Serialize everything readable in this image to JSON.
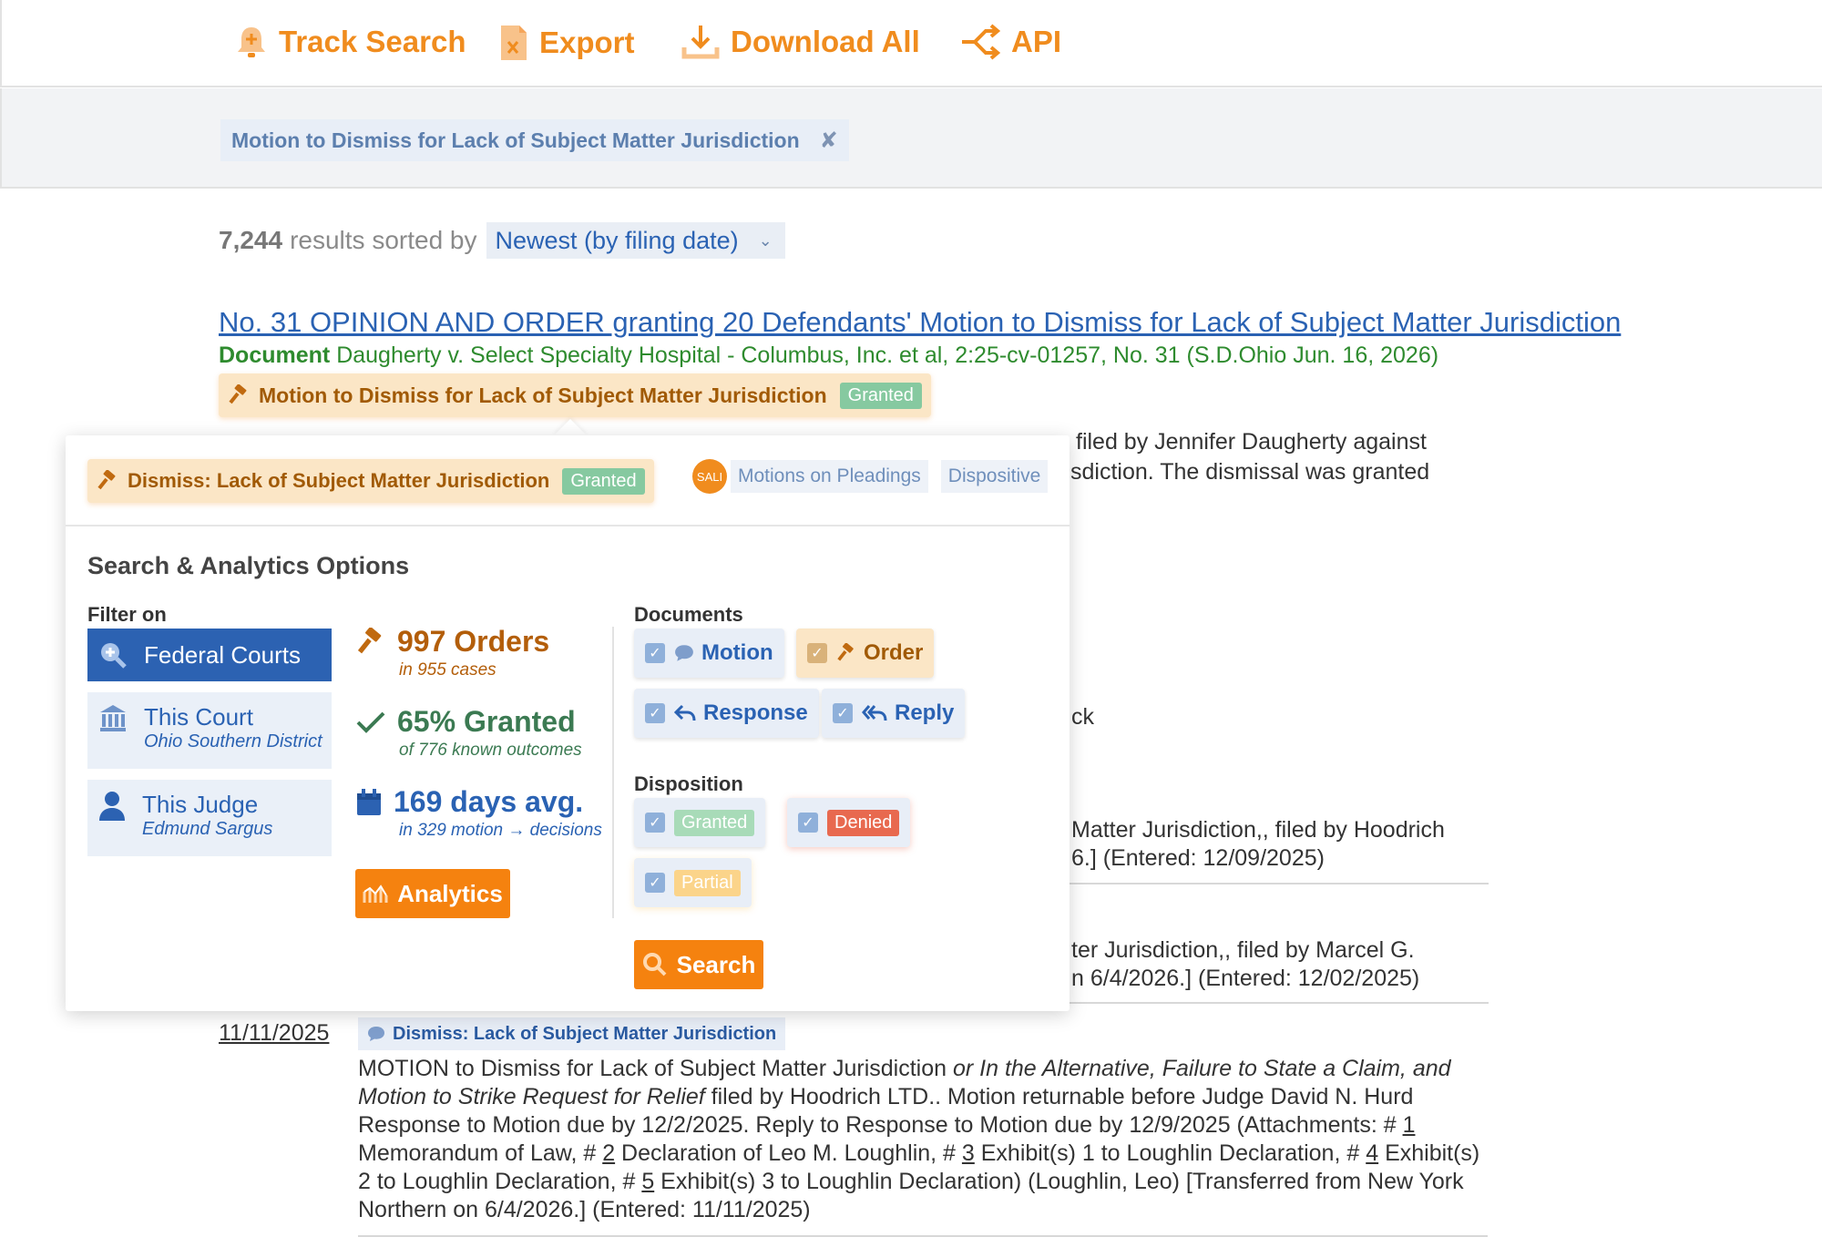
{
  "toolbar": {
    "track_search": "Track Search",
    "export": "Export",
    "download_all": "Download All",
    "api": "API"
  },
  "filter": {
    "chip_label": "Motion to Dismiss for Lack of Subject Matter Jurisdiction",
    "remove_glyph": "✘"
  },
  "results": {
    "count": "7,244",
    "sorted_by_text": "results sorted by",
    "sort_value": "Newest (by filing date)"
  },
  "result": {
    "title": "No. 31 OPINION AND ORDER granting 20 Defendants' Motion to Dismiss for Lack of Subject Matter Jurisdiction",
    "meta_label": "Document",
    "meta_text": "Daugherty v. Select Specialty Hospital - Columbus, Inc. et al, 2:25-cv-01257, No. 31 (S.D.Ohio Jun. 16, 2026)",
    "motion_tag": "Motion to Dismiss for Lack of Subject Matter Jurisdiction",
    "motion_status": "Granted"
  },
  "snippets": [
    "filed by Jennifer Daugherty against",
    "sdiction. The dismissal was granted",
    "ck",
    "Matter Jurisdiction,, filed by Hoodrich",
    "6.] (Entered: 12/09/2025)",
    "ter Jurisdiction,, filed by Marcel G.",
    "n 6/4/2026.] (Entered: 12/02/2025)"
  ],
  "docket": {
    "date": "11/11/2025",
    "tag": "Dismiss: Lack of Subject Matter Jurisdiction",
    "text_1": "MOTION to Dismiss for Lack of Subject Matter Jurisdiction ",
    "text_italic": "or In the Alternative, Failure to State a Claim, and Motion to Strike Request for Relief",
    "text_2": " filed by Hoodrich LTD.. Motion returnable before Judge David N. Hurd Response to Motion due by 12/2/2025. Reply to Response to Motion due by 12/9/2025 (Attachments: # ",
    "att_1": "1",
    "text_3": " Memorandum of Law, # ",
    "att_2": "2",
    "text_4": " Declaration of Leo M. Loughlin, # ",
    "att_3": "3",
    "text_5": " Exhibit(s) 1 to Loughlin Declaration, # ",
    "att_4": "4",
    "text_6": " Exhibit(s) 2 to Loughlin Declaration, # ",
    "att_5": "5",
    "text_7": " Exhibit(s) 3 to Loughlin Declaration) (Loughlin, Leo) [Transferred from New York Northern on 6/4/2026.] (Entered: 11/11/2025)"
  },
  "popover": {
    "tag": "Dismiss: Lack of Subject Matter Jurisdiction",
    "tag_status": "Granted",
    "sali_logo": "SALI",
    "category": "Motions on Pleadings",
    "dispositive": "Dispositive",
    "title": "Search & Analytics Options",
    "filter_on_label": "Filter on",
    "filters": {
      "federal": "Federal Courts",
      "court": "This Court",
      "court_sub": "Ohio Southern District",
      "judge": "This Judge",
      "judge_sub": "Edmund Sargus"
    },
    "stats": {
      "orders": "997 Orders",
      "orders_sub": "in 955 cases",
      "granted": "65% Granted",
      "granted_sub": "of 776 known outcomes",
      "days": "169 days avg.",
      "days_sub": "in 329 motion → decisions"
    },
    "analytics_button": "Analytics",
    "documents_label": "Documents",
    "documents": {
      "motion": "Motion",
      "order": "Order",
      "response": "Response",
      "reply": "Reply"
    },
    "disposition_label": "Disposition",
    "disposition": {
      "granted": "Granted",
      "denied": "Denied",
      "partial": "Partial"
    },
    "search_button": "Search"
  },
  "colors": {
    "accent_orange": "#f08c1e",
    "link_blue": "#2a62b3",
    "meta_green": "#2e8b2e"
  },
  "icons": [
    "bell-plus-icon",
    "export-file-icon",
    "download-icon",
    "api-share-icon",
    "gavel-icon",
    "search-plus-icon",
    "courthouse-icon",
    "person-icon",
    "check-icon",
    "calendar-icon",
    "chart-icon",
    "speech-bubble-icon",
    "reply-icon",
    "reply-all-icon",
    "search-icon"
  ]
}
